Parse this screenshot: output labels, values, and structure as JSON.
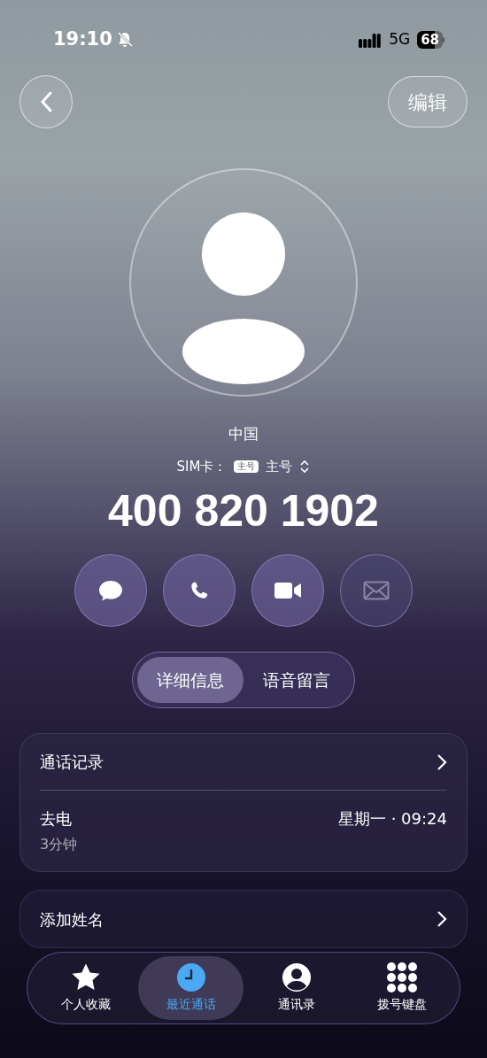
{
  "status_bar": {
    "time": "19:10",
    "network": "5G",
    "battery": "68"
  },
  "header": {
    "edit": "编辑"
  },
  "contact": {
    "region": "中国",
    "sim_label": "SIM卡：",
    "sim_badge": "主号",
    "sim_name": "主号",
    "number": "400 820 1902"
  },
  "actions": [
    {
      "kind": "message",
      "disabled": false
    },
    {
      "kind": "call",
      "disabled": false
    },
    {
      "kind": "video",
      "disabled": false
    },
    {
      "kind": "mail",
      "disabled": true
    }
  ],
  "tabs": [
    {
      "label": "详细信息",
      "selected": true
    },
    {
      "label": "语音留言",
      "selected": false
    }
  ],
  "call_log": {
    "title": "通话记录",
    "entries": [
      {
        "type": "去电",
        "duration": "3分钟",
        "time": "星期一 · 09:24"
      }
    ]
  },
  "add_name": "添加姓名",
  "bottom_nav": [
    {
      "kind": "star",
      "label": "个人收藏",
      "selected": false
    },
    {
      "kind": "clock",
      "label": "最近通话",
      "selected": true
    },
    {
      "kind": "person",
      "label": "通讯录",
      "selected": false
    },
    {
      "kind": "keypad",
      "label": "拨号键盘",
      "selected": false
    }
  ]
}
